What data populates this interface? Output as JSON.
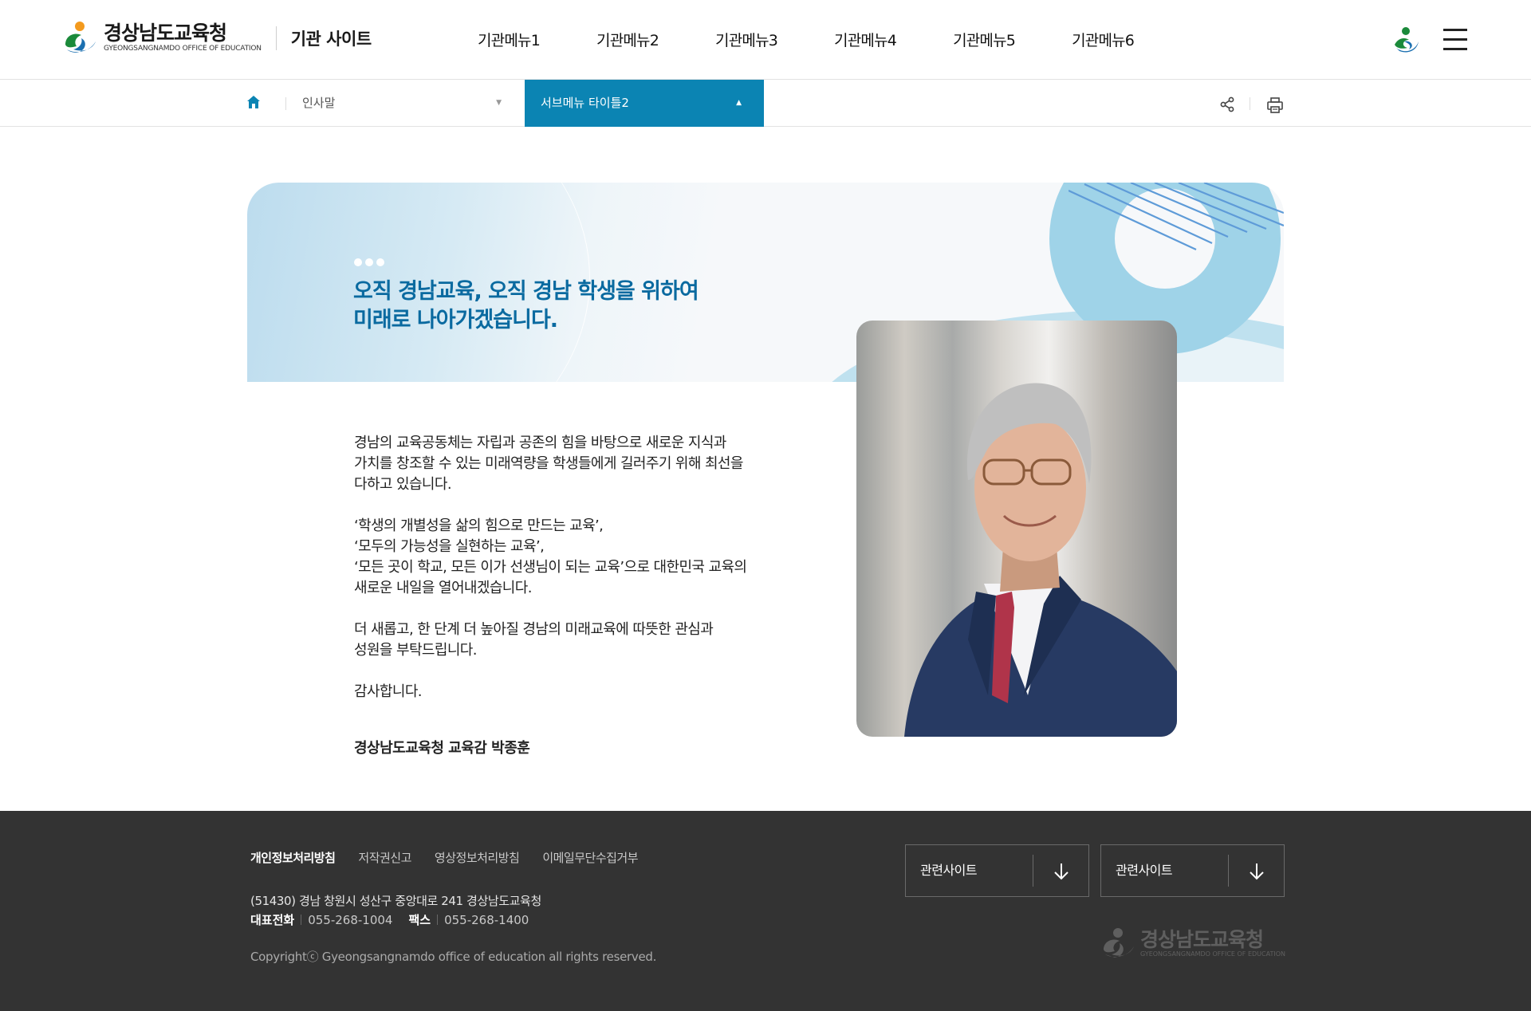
{
  "header": {
    "logo_ko": "경상남도교육청",
    "logo_en": "GYEONGSANGNAMDO OFFICE OF EDUCATION",
    "site_name": "기관 사이트",
    "menu": [
      "기관메뉴1",
      "기관메뉴2",
      "기관메뉴3",
      "기관메뉴4",
      "기관메뉴5",
      "기관메뉴6"
    ]
  },
  "location": {
    "depth1": "인사말",
    "depth2": "서브메뉴 타이틀2"
  },
  "greeting": {
    "headline": "오직 경남교육, 오직 경남 학생을 위하여\n미래로 나아가겠습니다.",
    "paragraphs": [
      "경남의 교육공동체는 자립과 공존의 힘을 바탕으로 새로운 지식과\n가치를 창조할 수 있는 미래역량을 학생들에게 길러주기 위해 최선을\n다하고 있습니다.",
      "‘학생의 개별성을 삶의 힘으로 만드는 교육’,\n‘모두의 가능성을 실현하는 교육’,\n‘모든 곳이 학교, 모든 이가 선생님이 되는 교육’으로 대한민국 교육의\n새로운 내일을 열어내겠습니다.",
      "더 새롭고, 한 단계 더 높아질 경남의 미래교육에 따뜻한 관심과\n성원을 부탁드립니다.",
      "감사합니다."
    ],
    "signature": "경상남도교육청 교육감 박종훈"
  },
  "footer": {
    "links": [
      "개인정보처리방침",
      "저작권신고",
      "영상정보처리방침",
      "이메일무단수집거부"
    ],
    "address": "(51430) 경남 창원시 성산구 중앙대로 241 경상남도교육청",
    "phone_label": "대표전화",
    "phone": "055-268-1004",
    "fax_label": "팩스",
    "fax": "055-268-1400",
    "copyright": "Copyrightⓒ Gyeongsangnamdo office of education all rights reserved.",
    "related_sites": [
      "관련사이트",
      "관련사이트"
    ],
    "logo_ko": "경상남도교육청",
    "logo_en": "GYEONGSANGNAMDO OFFICE OF EDUCATION"
  },
  "colors": {
    "primary": "#0b84b3",
    "headline": "#0a6aa0",
    "footer_bg": "#333333"
  },
  "icons": [
    "home-icon",
    "caret-down-icon",
    "caret-up-icon",
    "share-icon",
    "print-icon",
    "menu-icon",
    "arrow-down-icon",
    "mascot-icon"
  ]
}
